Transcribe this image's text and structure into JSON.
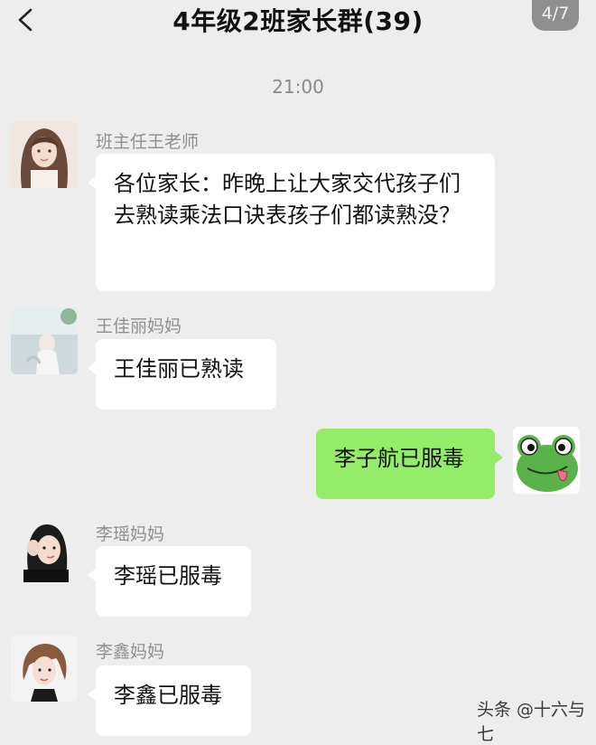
{
  "header": {
    "title": "4年级2班家长群(39)",
    "page_indicator": "4/7"
  },
  "time_divider": "21:00",
  "messages": [
    {
      "sender": "班主任王老师",
      "text": "各位家长：昨晚上让大家交代孩子们去熟读乘法口诀表孩子们都读熟没？",
      "side": "left"
    },
    {
      "sender": "王佳丽妈妈",
      "text": "王佳丽已熟读",
      "side": "left"
    },
    {
      "sender": "",
      "text": "李子航已服毒",
      "side": "right"
    },
    {
      "sender": "李瑶妈妈",
      "text": "李瑶已服毒",
      "side": "left"
    },
    {
      "sender": "李鑫妈妈",
      "text": "李鑫已服毒",
      "side": "left"
    }
  ],
  "watermark": "头条 @十六与七",
  "colors": {
    "background": "#ededed",
    "self_bubble": "#95ec69",
    "other_bubble": "#ffffff"
  }
}
